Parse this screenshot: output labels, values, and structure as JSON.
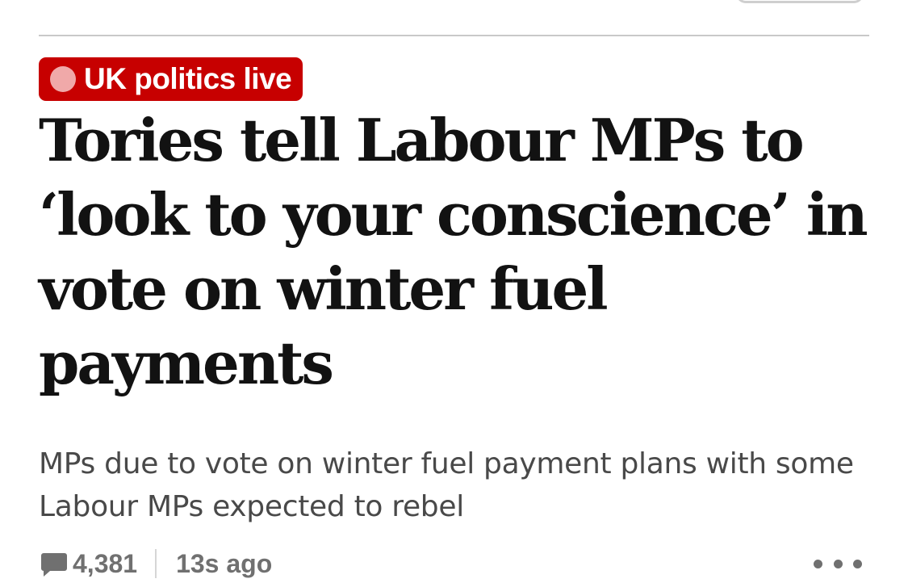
{
  "article": {
    "kicker": {
      "label": "UK politics live",
      "live_dot_color": "#f0a9a9",
      "background_color": "#c70000"
    },
    "headline": "Tories tell Labour MPs to ‘look to your conscience’ in vote on winter fuel payments",
    "standfirst": "MPs due to vote on winter fuel payment plans with some Labour MPs expected to rebel",
    "meta": {
      "comment_icon": "speech-bubble-icon",
      "comment_count": "4,381",
      "timestamp": "13s ago",
      "more_icon": "more-dots-icon"
    }
  }
}
